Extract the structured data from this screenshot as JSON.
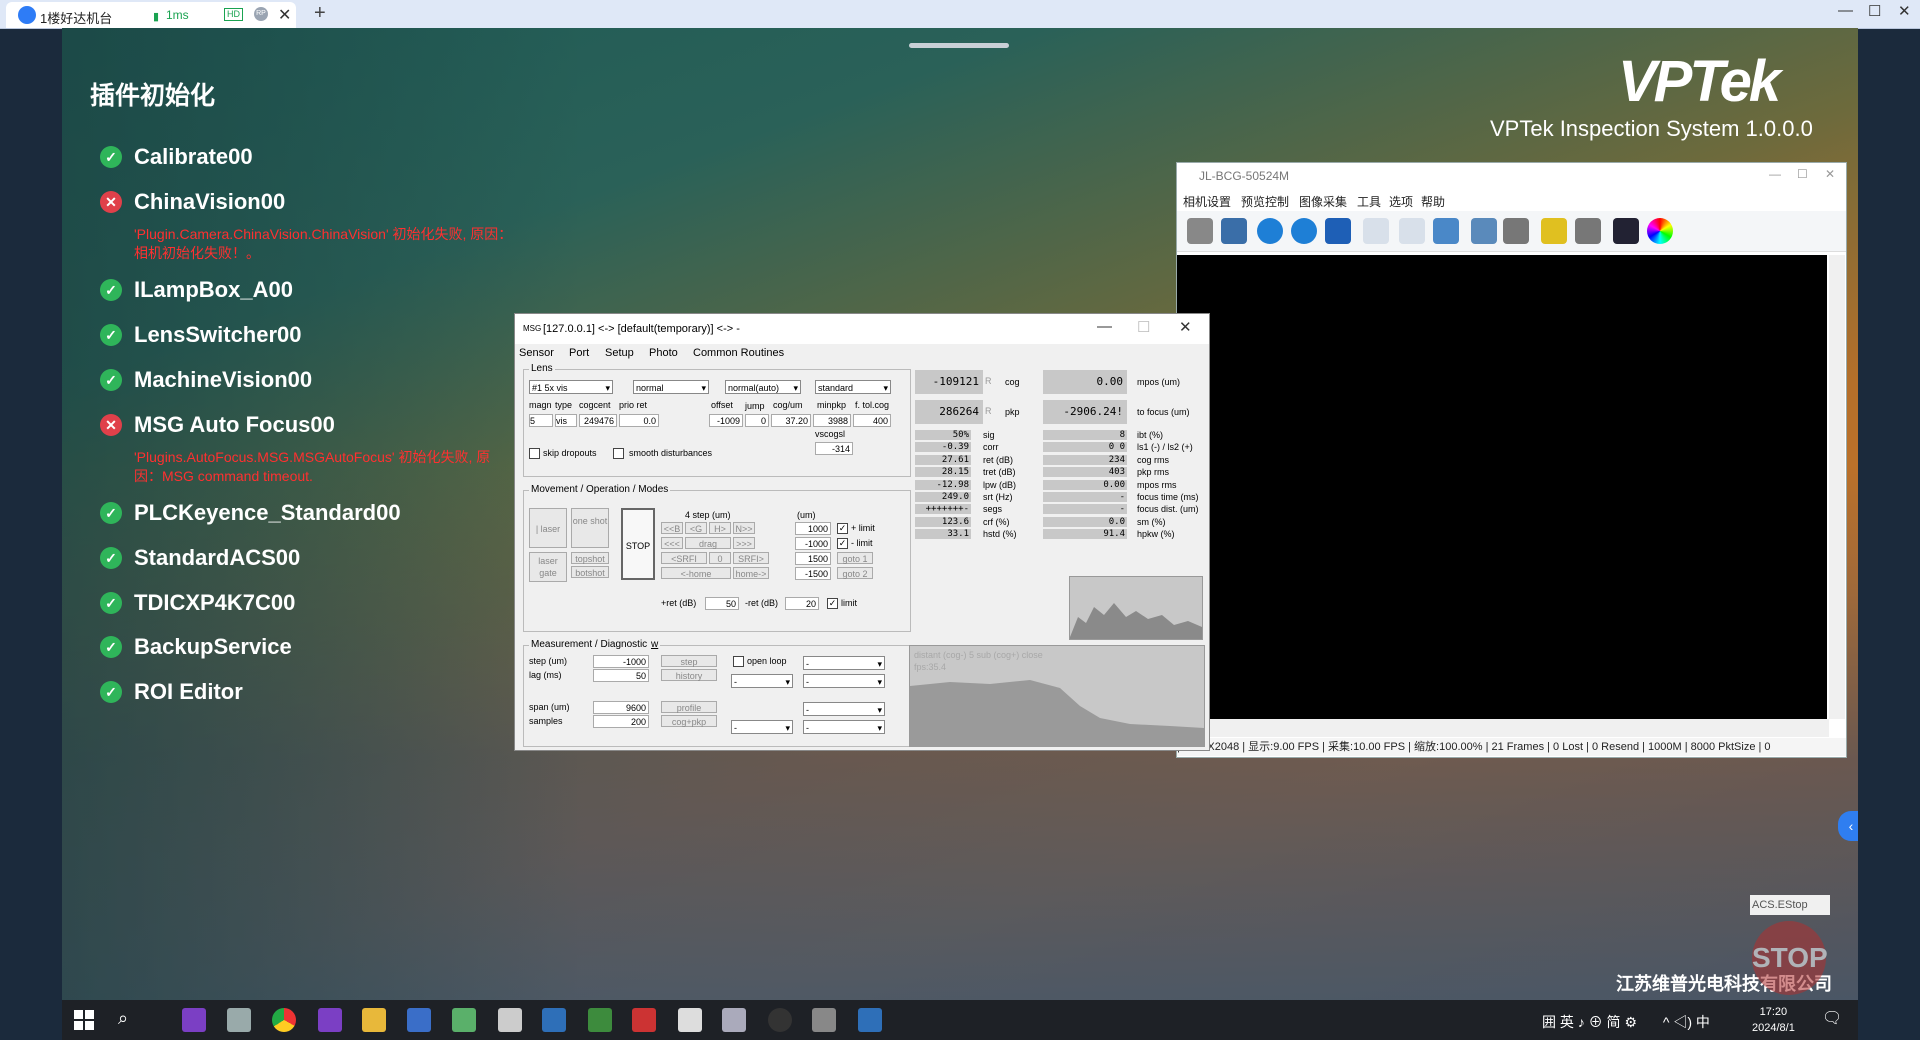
{
  "remote": {
    "tab_title": "1楼好达机台",
    "ping": "1ms",
    "hd": "HD",
    "rp": "RP",
    "close": "✕",
    "new_tab": "+",
    "win_min": "—",
    "win_max": "☐",
    "win_close": "✕"
  },
  "page_title": "插件初始化",
  "brand": {
    "logo": "VPTek",
    "system": "VPTek Inspection System 1.0.0.0",
    "company": "江苏维普光电科技有限公司"
  },
  "plugins": [
    {
      "name": "Calibrate00",
      "status": "ok"
    },
    {
      "name": "ChinaVision00",
      "status": "error",
      "message": "'Plugin.Camera.ChinaVision.ChinaVision' 初始化失败, 原因：相机初始化失败！。"
    },
    {
      "name": "ILampBox_A00",
      "status": "ok"
    },
    {
      "name": "LensSwitcher00",
      "status": "ok"
    },
    {
      "name": "MachineVision00",
      "status": "ok"
    },
    {
      "name": "MSG Auto Focus00",
      "status": "error",
      "message": "'Plugins.AutoFocus.MSG.MSGAutoFocus' 初始化失败, 原因：MSG command timeout."
    },
    {
      "name": "PLCKeyence_Standard00",
      "status": "ok"
    },
    {
      "name": "StandardACS00",
      "status": "ok"
    },
    {
      "name": "TDICXP4K7C00",
      "status": "ok"
    },
    {
      "name": "BackupService",
      "status": "ok"
    },
    {
      "name": "ROI Editor",
      "status": "ok"
    }
  ],
  "estop": {
    "label": "ACS.EStop",
    "button": "STOP"
  },
  "camera_window": {
    "title": "JL-BCG-50524M",
    "menu": [
      "相机设置",
      "预览控制",
      "图像采集",
      "工具",
      "选项",
      "帮助"
    ],
    "status": "| 2592X2048 | 显示:9.00 FPS | 采集:10.00 FPS | 缩放:100.00% | 21 Frames | 0 Lost | 0 Resend | 1000M | 8000 PktSize | 0"
  },
  "msg_dialog": {
    "title": "[127.0.0.1] <-> [default(temporary)] <-> -",
    "icon": "MSG",
    "menu": [
      "Sensor",
      "Port",
      "Setup",
      "Photo",
      "Common Routines"
    ],
    "lens": {
      "group": "Lens",
      "lens_select": "#1 5x vis",
      "mode1": "normal",
      "mode2": "normal(auto)",
      "mode3": "standard",
      "headers": [
        "magn",
        "type",
        "cogcent",
        "prio ret",
        "offset",
        "jump",
        "cog/um",
        "minpkp",
        "f. tol.cog"
      ],
      "magn": "5",
      "type": "vis",
      "cogcent": "249476",
      "prio_ret": "0.0",
      "offset": "-1009",
      "jump": "0",
      "cog_um": "37.20",
      "minpkp": "3988",
      "ftol": "400",
      "vscogsl_label": "vscogsl",
      "vscogsl": "-314",
      "skip_dropouts": "skip dropouts",
      "smooth": "smooth disturbances"
    },
    "movement": {
      "group": "Movement / Operation / Modes",
      "laser": "| laser",
      "one_shot": "one shot",
      "laser_gate": "laser gate",
      "topshot": "topshot",
      "botshot": "botshot",
      "stop": "STOP",
      "step_label": "4 step (um)",
      "um_label": "(um)",
      "btns": [
        "<<B",
        "<G",
        "H>",
        "N>>",
        "<<<",
        "drag",
        ">>>",
        "<SRFI",
        "0",
        "SRFI>",
        "<-home",
        "home->"
      ],
      "plus_val": "1000",
      "plus_label": "+ limit",
      "minus_val": "-1000",
      "minus_label": "- limit",
      "goto1_val": "1500",
      "goto1": "goto 1",
      "goto2_val": "-1500",
      "goto2": "goto 2",
      "pret_label": "+ret (dB)",
      "pret": "50",
      "mret_label": "-ret (dB)",
      "mret": "20",
      "limit": "limit"
    },
    "measurement": {
      "group": "Measurement / Diagnostic",
      "w": "w",
      "step_label": "step (um)",
      "step": "-1000",
      "lag_label": "lag (ms)",
      "lag": "50",
      "span_label": "span (um)",
      "span": "9600",
      "samples_label": "samples",
      "samples": "200",
      "step_btn": "step",
      "history_btn": "history",
      "profile_btn": "profile",
      "cogpkp_btn": "cog+pkp",
      "open_loop": "open loop",
      "dash": "-"
    },
    "readouts": {
      "cog_val": "-109121",
      "cog_label": "cog",
      "mpos_val": "0.00",
      "mpos_label": "mpos (um)",
      "pkp_val": "286264",
      "pkp_label": "pkp",
      "focus_val": "-2906.24!",
      "focus_label": "to focus (um)",
      "r_flag": "R",
      "rows": [
        {
          "v1": "50%",
          "l1": "sig",
          "v2": "8",
          "l2": "ibt (%)"
        },
        {
          "v1": "-0.39",
          "l1": "corr",
          "v2": "0  0",
          "l2": "ls1 (-) / ls2 (+)"
        },
        {
          "v1": "27.61",
          "l1": "ret (dB)",
          "v2": "234",
          "l2": "cog rms"
        },
        {
          "v1": "28.15",
          "l1": "tret (dB)",
          "v2": "403",
          "l2": "pkp rms"
        },
        {
          "v1": "-12.98",
          "l1": "lpw (dB)",
          "v2": "0.00",
          "l2": "mpos rms"
        },
        {
          "v1": "249.0",
          "l1": "srt (Hz)",
          "v2": "-",
          "l2": "focus time (ms)"
        },
        {
          "v1": "+++++++-",
          "l1": "segs",
          "v2": "-",
          "l2": "focus dist. (um)"
        },
        {
          "v1": "123.6",
          "l1": "crf (%)",
          "v2": "0.0",
          "l2": "sm (%)"
        },
        {
          "v1": "33.1",
          "l1": "hstd (%)",
          "v2": "91.4",
          "l2": "hpkw (%)"
        }
      ],
      "plot_text": "distant (cog-)  5 sub   (cog+) close",
      "plot_fps": "fps:35.4"
    }
  },
  "taskbar": {
    "tray": "囲 英 ♪ ⊕ 简 ⚙",
    "tray2": "^ ◁) 中",
    "time": "17:20",
    "date": "2024/8/1"
  }
}
